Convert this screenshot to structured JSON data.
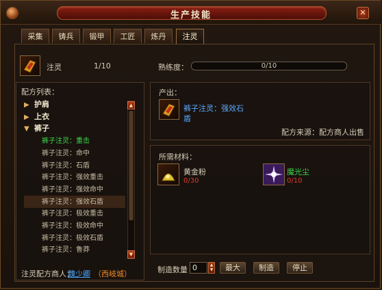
{
  "window": {
    "title": "生产技能",
    "close_label": "✕"
  },
  "tabs": [
    {
      "label": "采集"
    },
    {
      "label": "铸兵"
    },
    {
      "label": "锻甲"
    },
    {
      "label": "工匠"
    },
    {
      "label": "炼丹"
    },
    {
      "label": "注灵"
    }
  ],
  "skill": {
    "name": "注灵",
    "level": "1/10",
    "proficiency_label": "熟练度：",
    "proficiency_value": "0/10",
    "proficiency_progress": 0
  },
  "recipes": {
    "header": "配方列表：",
    "items": [
      {
        "label": "护肩",
        "type": "category",
        "icon": "chevron-right-icon"
      },
      {
        "label": "上衣",
        "type": "category",
        "icon": "chevron-right-icon"
      },
      {
        "label": "裤子",
        "type": "category",
        "icon": "chevron-down-icon"
      },
      {
        "label": "裤子注灵：重击",
        "type": "recipe",
        "color": "#3cd84a"
      },
      {
        "label": "裤子注灵：命中",
        "type": "recipe"
      },
      {
        "label": "裤子注灵：石盾",
        "type": "recipe"
      },
      {
        "label": "裤子注灵：强效重击",
        "type": "recipe"
      },
      {
        "label": "裤子注灵：强效命中",
        "type": "recipe"
      },
      {
        "label": "裤子注灵：强效石盾",
        "type": "recipe",
        "selected": true
      },
      {
        "label": "裤子注灵：极效重击",
        "type": "recipe"
      },
      {
        "label": "裤子注灵：极效命中",
        "type": "recipe"
      },
      {
        "label": "裤子注灵：极效石盾",
        "type": "recipe"
      },
      {
        "label": "裤子注灵：鲁莽",
        "type": "recipe"
      }
    ]
  },
  "output": {
    "header": "产出：",
    "name_line1": "裤子注灵：强效石",
    "name_line2": "盾",
    "source": "配方来源：配方商人出售"
  },
  "materials": {
    "header": "所需材料：",
    "items": [
      {
        "name": "黄金粉",
        "count": "0/30",
        "icon": "gold-powder-icon",
        "name_color": "#f0e6d0"
      },
      {
        "name": "魔光尘",
        "count": "0/10",
        "icon": "magic-dust-icon",
        "name_color": "#3cd84a"
      }
    ]
  },
  "merchant": {
    "label": "注灵配方商人：",
    "name": "魏少卿",
    "location": "（西岐城）"
  },
  "craft": {
    "qty_label": "制造数量",
    "qty_value": "0",
    "max_label": "最大",
    "make_label": "制造",
    "stop_label": "停止"
  },
  "colors": {
    "accent_green": "#3cd84a",
    "count_red": "#e03a2a",
    "title_gold": "#f2e6cc",
    "link_blue": "#4aa8ff",
    "location_orange": "#f08a2a"
  }
}
